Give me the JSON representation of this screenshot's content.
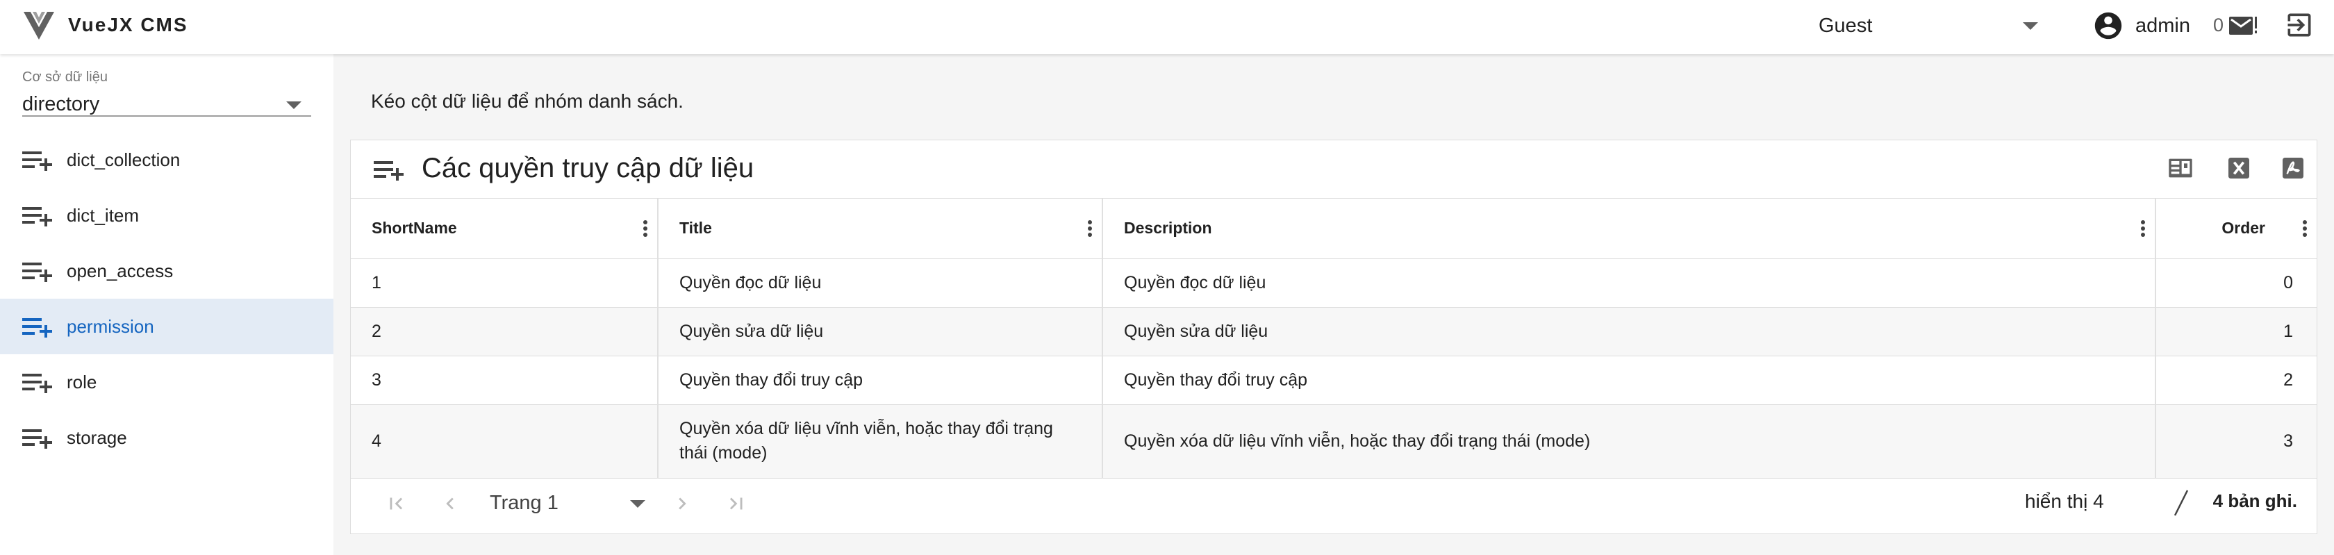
{
  "app": {
    "brand": "VueJX CMS"
  },
  "header": {
    "role_value": "Guest",
    "user_name": "admin",
    "notification_count": "0"
  },
  "sidebar": {
    "database_label": "Cơ sở dữ liệu",
    "database_value": "directory",
    "items": [
      {
        "label": "dict_collection",
        "active": false
      },
      {
        "label": "dict_item",
        "active": false
      },
      {
        "label": "open_access",
        "active": false
      },
      {
        "label": "permission",
        "active": true
      },
      {
        "label": "role",
        "active": false
      },
      {
        "label": "storage",
        "active": false
      }
    ]
  },
  "main": {
    "group_hint": "Kéo cột dữ liệu để nhóm danh sách.",
    "card_title": "Các quyền truy cập dữ liệu",
    "columns": [
      "ShortName",
      "Title",
      "Description",
      "Order"
    ],
    "rows": [
      {
        "shortname": "1",
        "title": "Quyền đọc dữ liệu",
        "description": "Quyền đọc dữ liệu",
        "order": "0"
      },
      {
        "shortname": "2",
        "title": "Quyền sửa dữ liệu",
        "description": "Quyền sửa dữ liệu",
        "order": "1"
      },
      {
        "shortname": "3",
        "title": "Quyền thay đổi truy cập",
        "description": "Quyền thay đổi truy cập",
        "order": "2"
      },
      {
        "shortname": "4",
        "title": "Quyền xóa dữ liệu vĩnh viễn, hoặc thay đổi trạng thái (mode)",
        "description": "Quyền xóa dữ liệu vĩnh viễn, hoặc thay đổi trạng thái (mode)",
        "order": "3"
      }
    ],
    "pagination": {
      "page_label": "Trang 1",
      "shown_label": "hiển thị 4",
      "total_label": "4 bản ghi."
    }
  },
  "colors": {
    "accent": "#1565c0",
    "active_bg": "#e3ebf5"
  }
}
